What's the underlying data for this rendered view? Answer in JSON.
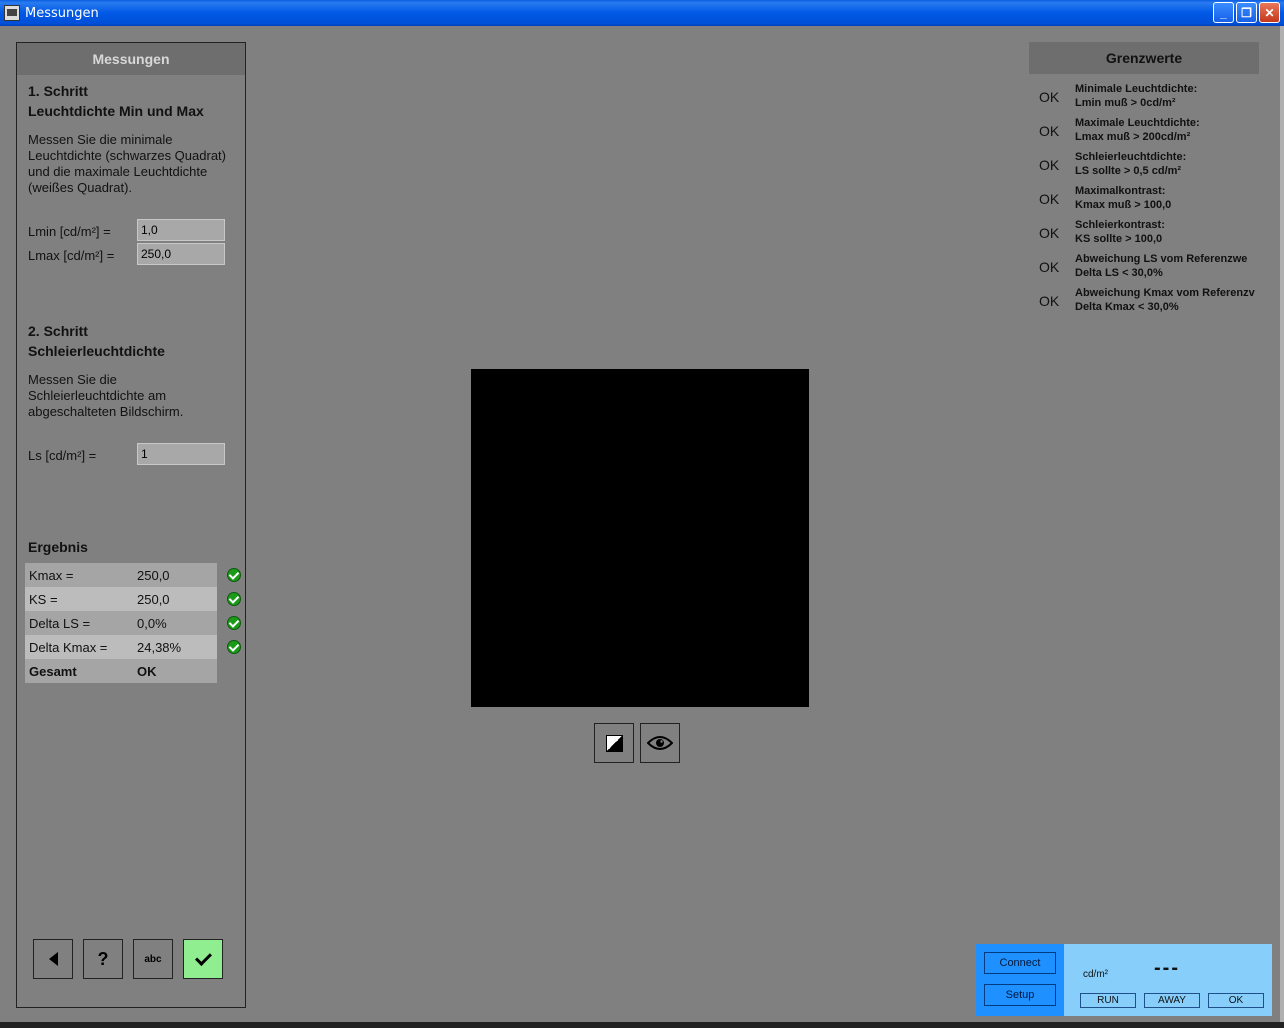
{
  "window": {
    "title": "Messungen"
  },
  "left": {
    "header": "Messungen",
    "step1_title": "1. Schritt",
    "step1_subtitle": "Leuchtdichte Min und Max",
    "step1_desc": "Messen Sie die minimale Leuchtdichte (schwarzes Quadrat) und die maximale Leuchtdichte (weißes Quadrat).",
    "lmin_label": "Lmin [cd/m²] =",
    "lmin_value": "1,0",
    "lmax_label": "Lmax [cd/m²] =",
    "lmax_value": "250,0",
    "step2_title": "2. Schritt",
    "step2_subtitle": "Schleierleuchtdichte",
    "step2_desc": "Messen Sie die Schleierleuchtdichte am abgeschalteten Bildschirm.",
    "ls_label": "Ls [cd/m²] =",
    "ls_value": "1",
    "result_title": "Ergebnis",
    "results": [
      {
        "label": "Kmax =",
        "value": "250,0"
      },
      {
        "label": "KS =",
        "value": "250,0"
      },
      {
        "label": "Delta LS =",
        "value": "0,0%"
      },
      {
        "label": "Delta Kmax =",
        "value": "24,38%"
      }
    ],
    "total_label": "Gesamt",
    "total_value": "OK",
    "buttons": {
      "help": "?",
      "abc": "abc"
    }
  },
  "limits": {
    "header": "Grenzwerte",
    "items": [
      {
        "status": "OK",
        "line1": "Minimale Leuchtdichte:",
        "line2": "Lmin muß > 0cd/m²"
      },
      {
        "status": "OK",
        "line1": "Maximale Leuchtdichte:",
        "line2": "Lmax muß > 200cd/m²"
      },
      {
        "status": "OK",
        "line1": "Schleierleuchtdichte:",
        "line2": "LS sollte > 0,5 cd/m²"
      },
      {
        "status": "OK",
        "line1": "Maximalkontrast:",
        "line2": "Kmax muß > 100,0"
      },
      {
        "status": "OK",
        "line1": "Schleierkontrast:",
        "line2": "KS sollte > 100,0"
      },
      {
        "status": "OK",
        "line1": "Abweichung LS vom Referenzwe",
        "line2": "Delta LS < 30,0%"
      },
      {
        "status": "OK",
        "line1": "Abweichung Kmax vom Referenzv",
        "line2": "Delta Kmax < 30,0%"
      }
    ]
  },
  "device": {
    "connect": "Connect",
    "setup": "Setup",
    "unit": "cd/m²",
    "value": "---",
    "run": "RUN",
    "away": "AWAY",
    "ok": "OK"
  },
  "colors": {
    "accept_button": "#90ee90",
    "device_blue": "#1e90ff",
    "device_light": "#87cefa",
    "check_green": "#1b9a1b"
  }
}
